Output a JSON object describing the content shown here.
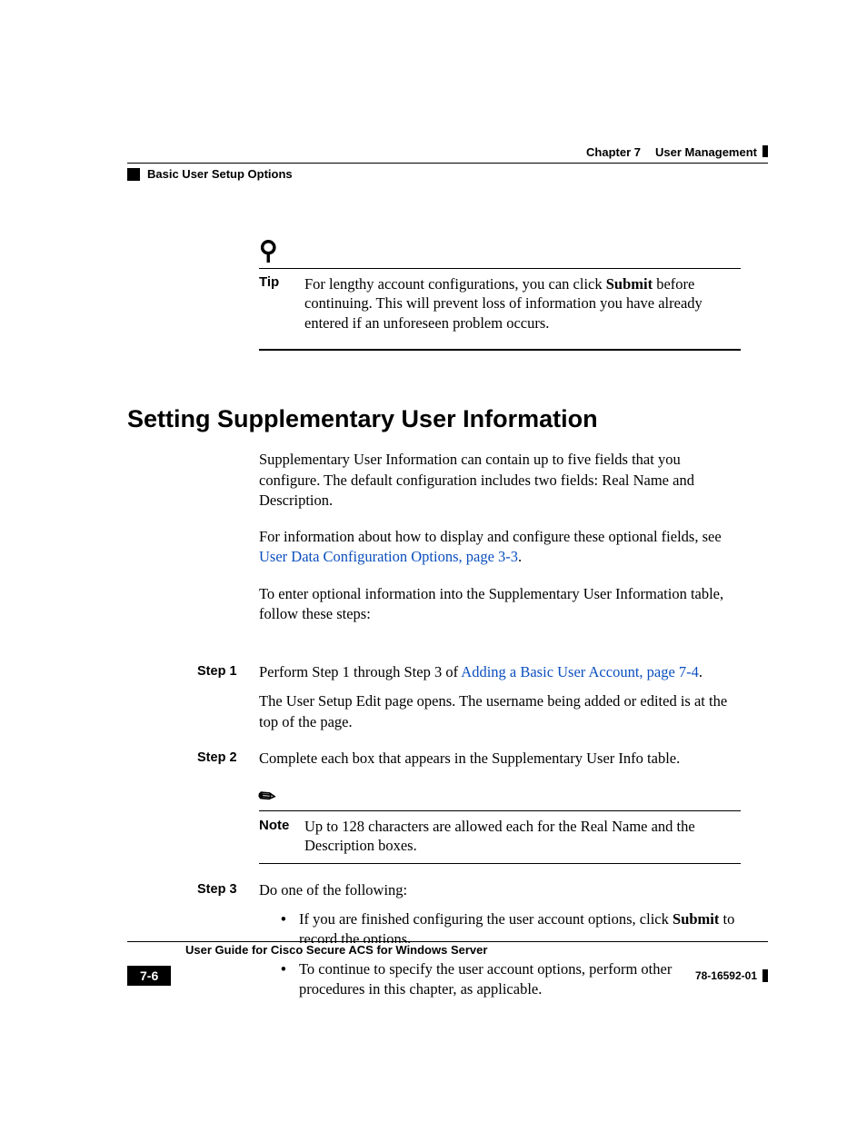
{
  "header": {
    "chapter_label": "Chapter 7",
    "chapter_title": "User Management",
    "section_label": "Basic User Setup Options"
  },
  "tip": {
    "label": "Tip",
    "text_pre": "For lengthy account configurations, you can click ",
    "submit_word": "Submit",
    "text_post": " before continuing. This will prevent loss of information you have already entered if an unforeseen problem occurs."
  },
  "heading": "Setting Supplementary User Information",
  "intro": {
    "p1": "Supplementary User Information can contain up to five fields that you configure. The default configuration includes two fields: Real Name and Description.",
    "p2_pre": "For information about how to display and configure these optional fields, see ",
    "p2_link": "User Data Configuration Options, page 3-3",
    "p2_post": ".",
    "p3": "To enter optional information into the Supplementary User Information table, follow these steps:"
  },
  "steps": {
    "s1_label": "Step 1",
    "s1_text_pre": "Perform Step 1 through Step 3 of ",
    "s1_link": "Adding a Basic User Account, page 7-4",
    "s1_text_post": ".",
    "s1_follow": "The User Setup Edit page opens. The username being added or edited is at the top of the page.",
    "s2_label": "Step 2",
    "s2_text": "Complete each box that appears in the Supplementary User Info table.",
    "note_label": "Note",
    "note_text": "Up to 128 characters are allowed each for the Real Name and the Description boxes.",
    "s3_label": "Step 3",
    "s3_text": "Do one of the following:",
    "s3_b1_pre": "If you are finished configuring the user account options, click ",
    "s3_b1_bold": "Submit",
    "s3_b1_post": " to record the options.",
    "s3_b2": "To continue to specify the user account options, perform other procedures in this chapter, as applicable."
  },
  "footer": {
    "guide_title": "User Guide for Cisco Secure ACS for Windows Server",
    "page_number": "7-6",
    "doc_id": "78-16592-01"
  }
}
